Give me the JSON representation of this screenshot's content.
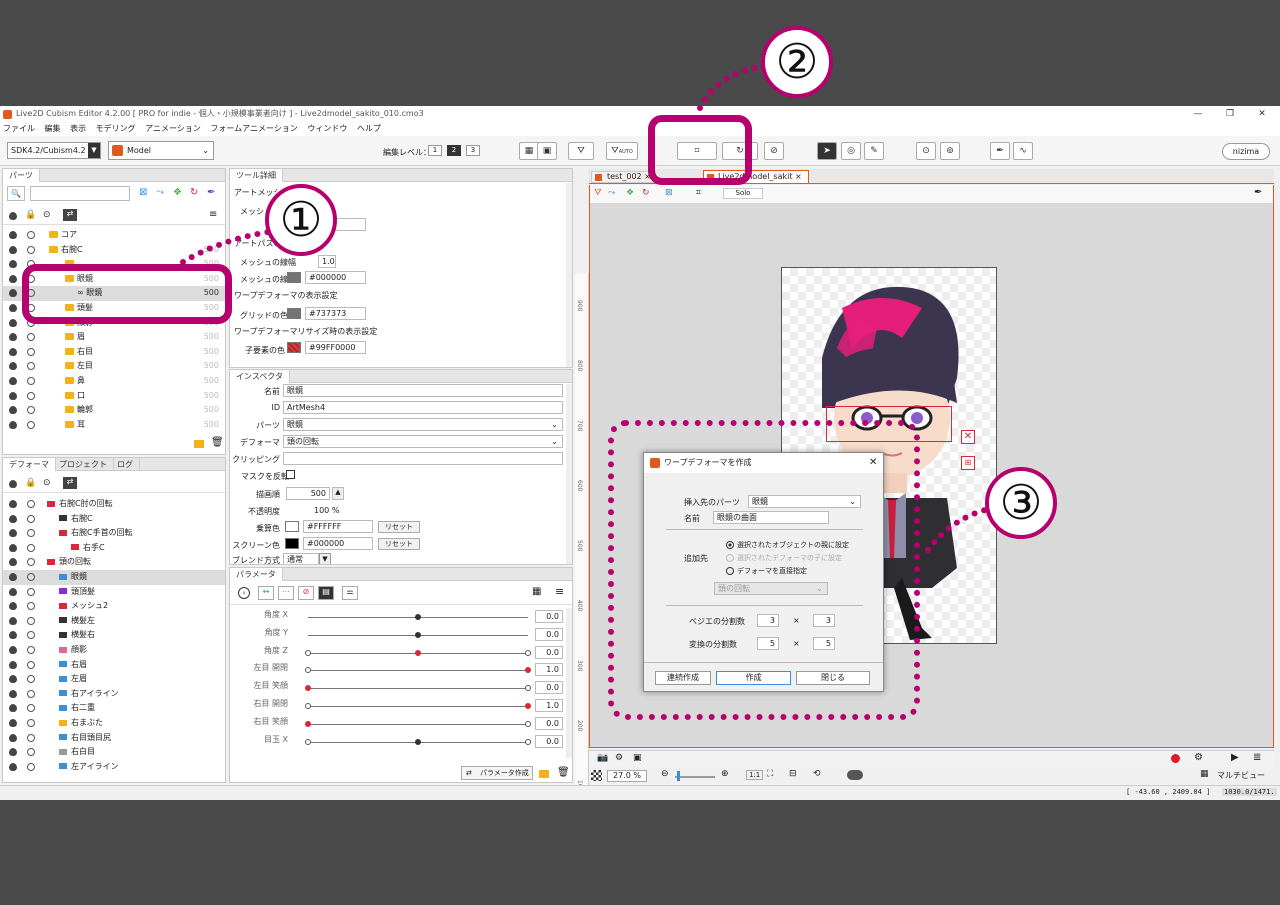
{
  "window": {
    "title": "Live2D Cubism Editor 4.2.00 [ PRO for indie - 個人・小規模事業者向け ] - Live2dmodel_sakito_010.cmo3"
  },
  "menu": [
    "ファイル",
    "編集",
    "表示",
    "モデリング",
    "アニメーション",
    "フォームアニメーション",
    "ウィンドウ",
    "ヘルプ"
  ],
  "toolbar": {
    "sdk": "SDK4.2/Cubism4.2",
    "mode": "Model",
    "edit_level_label": "編集レベル：",
    "levels": [
      "1",
      "2",
      "3"
    ],
    "auto": "AUTO",
    "nizima": "nizima"
  },
  "parts": {
    "tab": "パーツ",
    "items": [
      {
        "label": "コア",
        "num": ""
      },
      {
        "label": "右腕C",
        "num": "500"
      },
      {
        "label": "",
        "num": "500"
      },
      {
        "label": "眼鏡",
        "num": "500"
      },
      {
        "label": "眼鏡",
        "num": "500"
      },
      {
        "label": "頭髪",
        "num": "500"
      },
      {
        "label": "顔影",
        "num": "500"
      },
      {
        "label": "眉",
        "num": "500"
      },
      {
        "label": "右目",
        "num": "500"
      },
      {
        "label": "左目",
        "num": "500"
      },
      {
        "label": "鼻",
        "num": "500"
      },
      {
        "label": "口",
        "num": "500"
      },
      {
        "label": "輪郭",
        "num": "500"
      },
      {
        "label": "耳",
        "num": "500"
      }
    ]
  },
  "deformer": {
    "tabs": [
      "デフォーマ",
      "プロジェクト",
      "ログ"
    ],
    "items": [
      "右腕C肘の回転",
      "右腕C",
      "右腕C手首の回転",
      "右手C",
      "頭の回転",
      "眼鏡",
      "頭頂髪",
      "メッシュ2",
      "横髪左",
      "横髪右",
      "顔影",
      "右眉",
      "左眉",
      "右アイライン",
      "右二重",
      "右まぶた",
      "右目頭目尻",
      "右白目",
      "左アイライン"
    ]
  },
  "tool_detail": {
    "tab": "ツール詳細",
    "art_mesh": "アートメッシュ",
    "mesh": "メッシュの",
    "art_path": "アートパスの",
    "mesh_line_width": "メッシュの線幅",
    "mesh_line_width_val": "1.0",
    "mesh_line_color_label": "メッシュの線色",
    "mesh_line_color": "#000000",
    "warp_display": "ワープデフォーマの表示設定",
    "grid_color_label": "グリッドの色",
    "grid_color": "#737373",
    "warp_resize": "ワープデフォーマリサイズ時の表示設定",
    "child_color_label": "子要素の色",
    "child_color": "#99FF0000"
  },
  "inspector": {
    "tab": "インスペクタ",
    "name_label": "名前",
    "name": "眼鏡",
    "id_label": "ID",
    "id": "ArtMesh4",
    "parts_label": "パーツ",
    "parts": "眼鏡",
    "deformer_label": "デフォーマ",
    "deformer": "頭の回転",
    "clipping_label": "クリッピング",
    "mask_invert": "マスクを反転",
    "draw_order_label": "描画順",
    "draw_order": "500",
    "opacity_label": "不透明度",
    "opacity": "100 %",
    "multiply_label": "乗算色",
    "multiply": "#FFFFFF",
    "screen_label": "スクリーン色",
    "screen": "#000000",
    "reset": "リセット",
    "blend_label": "ブレンド方式",
    "blend": "通常"
  },
  "parameters": {
    "tab": "パラメータ",
    "items": [
      {
        "label": "角度 X",
        "value": "0.0",
        "pos": 0.5
      },
      {
        "label": "角度 Y",
        "value": "0.0",
        "pos": 0.5
      },
      {
        "label": "角度 Z",
        "value": "0.0",
        "pos": 0.5
      },
      {
        "label": "左目 開閉",
        "value": "1.0",
        "pos": 1.0
      },
      {
        "label": "左目 笑顔",
        "value": "0.0",
        "pos": 0.0
      },
      {
        "label": "右目 開閉",
        "value": "1.0",
        "pos": 1.0
      },
      {
        "label": "右目 笑顔",
        "value": "0.0",
        "pos": 0.0
      },
      {
        "label": "目玉 X",
        "value": "0.0",
        "pos": 0.5
      }
    ],
    "create_button": "パラメータ作成"
  },
  "viewport": {
    "tabs": [
      "test_002",
      "Live2dmodel_sakit"
    ],
    "solo": "Solo",
    "zoom": "27.0 %",
    "multiview": "マルチビュー",
    "coords": "[ -43.60 , 2409.04 ]",
    "size": "1030.0/1471.",
    "ruler": [
      "900",
      "800",
      "700",
      "600",
      "500",
      "400",
      "300",
      "200",
      "100",
      "0"
    ]
  },
  "dialog": {
    "title": "ワープデフォーマを作成",
    "target_part_label": "挿入先のパーツ",
    "target_part": "眼鏡",
    "name_label": "名前",
    "name": "眼鏡の曲面",
    "dest_label": "追加先",
    "opt1": "選択されたオブジェクトの親に設定",
    "opt2": "選択されたデフォーマの子に設定",
    "opt3": "デフォーマを直接指定",
    "deformer_select": "頭の回転",
    "bezier_label": "ベジエの分割数",
    "bezier_x": "3",
    "bezier_y": "3",
    "transform_label": "変換の分割数",
    "transform_x": "5",
    "transform_y": "5",
    "times": "×",
    "btn_continuous": "連続作成",
    "btn_create": "作成",
    "btn_close": "閉じる"
  },
  "annotations": [
    "①",
    "②",
    "③"
  ],
  "colors": {
    "accent": "#b5006e",
    "orange": "#e05a1e"
  }
}
